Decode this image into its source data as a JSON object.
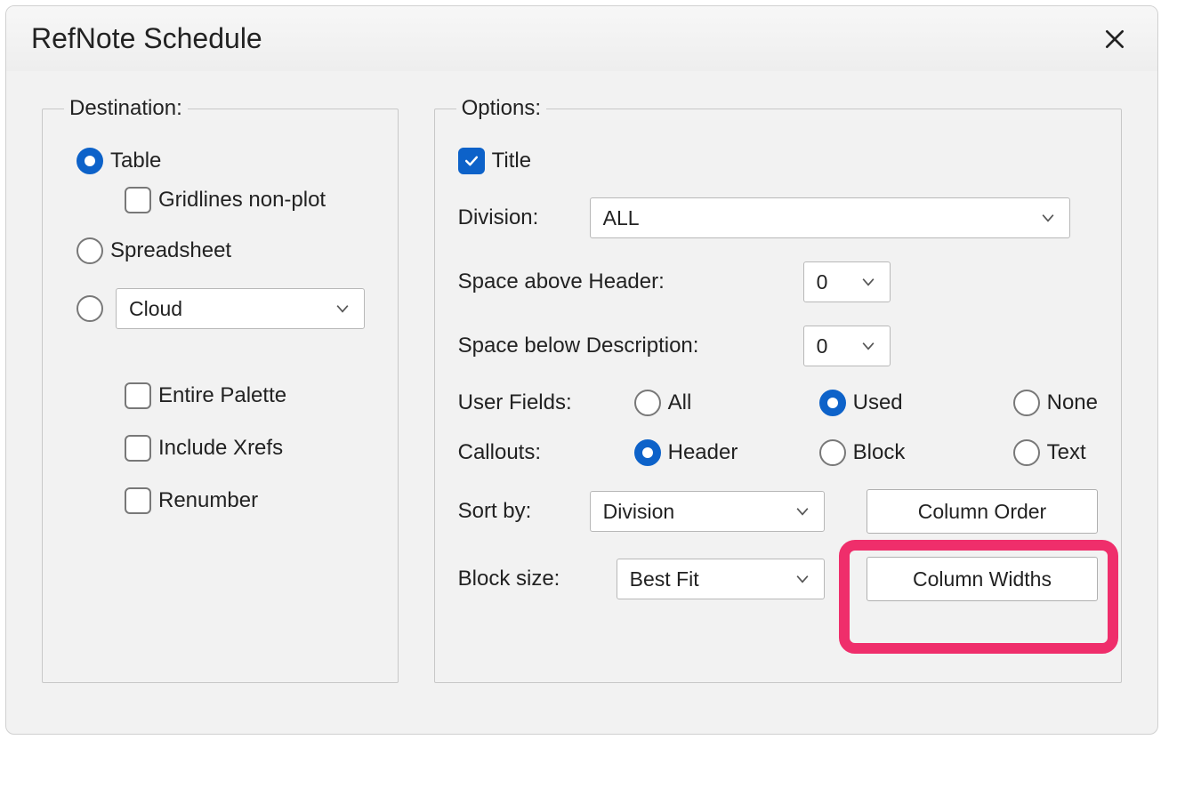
{
  "dialog": {
    "title": "RefNote Schedule"
  },
  "destination": {
    "legend": "Destination:",
    "table_label": "Table",
    "gridlines_label": "Gridlines non-plot",
    "spreadsheet_label": "Spreadsheet",
    "cloud_value": "Cloud",
    "entire_palette_label": "Entire Palette",
    "include_xrefs_label": "Include Xrefs",
    "renumber_label": "Renumber"
  },
  "options": {
    "legend": "Options:",
    "title_label": "Title",
    "division_label": "Division:",
    "division_value": "ALL",
    "space_above_label": "Space above Header:",
    "space_above_value": "0",
    "space_below_label": "Space below Description:",
    "space_below_value": "0",
    "user_fields_label": "User Fields:",
    "uf_all": "All",
    "uf_used": "Used",
    "uf_none": "None",
    "callouts_label": "Callouts:",
    "co_header": "Header",
    "co_block": "Block",
    "co_text": "Text",
    "sort_by_label": "Sort by:",
    "sort_by_value": "Division",
    "column_order_label": "Column Order",
    "block_size_label": "Block size:",
    "block_size_value": "Best Fit",
    "column_widths_label": "Column Widths"
  }
}
